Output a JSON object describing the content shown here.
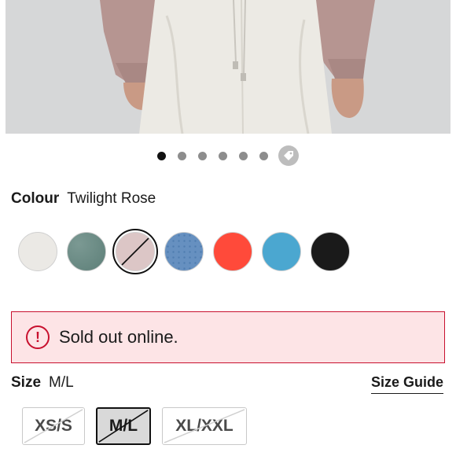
{
  "gallery": {
    "dot_count": 6,
    "active_index": 0
  },
  "colour": {
    "label": "Colour",
    "selected_name": "Twilight Rose",
    "swatches": [
      {
        "color": "#ebe9e5",
        "selected": false
      },
      {
        "color": "#6b8c86",
        "selected": false
      },
      {
        "color": "#dcc6c6",
        "selected": true,
        "unavailable": true
      },
      {
        "color": "#5c87b8",
        "selected": false
      },
      {
        "color": "#ff4a3a",
        "selected": false
      },
      {
        "color": "#4ba7d0",
        "selected": false
      },
      {
        "color": "#1a1a1a",
        "selected": false
      }
    ]
  },
  "alert": {
    "text": "Sold out online."
  },
  "size": {
    "label": "Size",
    "selected_value": "M/L",
    "guide_label": "Size Guide",
    "options": [
      {
        "label": "XS/S",
        "selected": false
      },
      {
        "label": "M/L",
        "selected": true
      },
      {
        "label": "XL/XXL",
        "selected": false
      }
    ]
  },
  "colors": {
    "alert_border": "#c8102e",
    "alert_bg": "#fde4e6"
  }
}
